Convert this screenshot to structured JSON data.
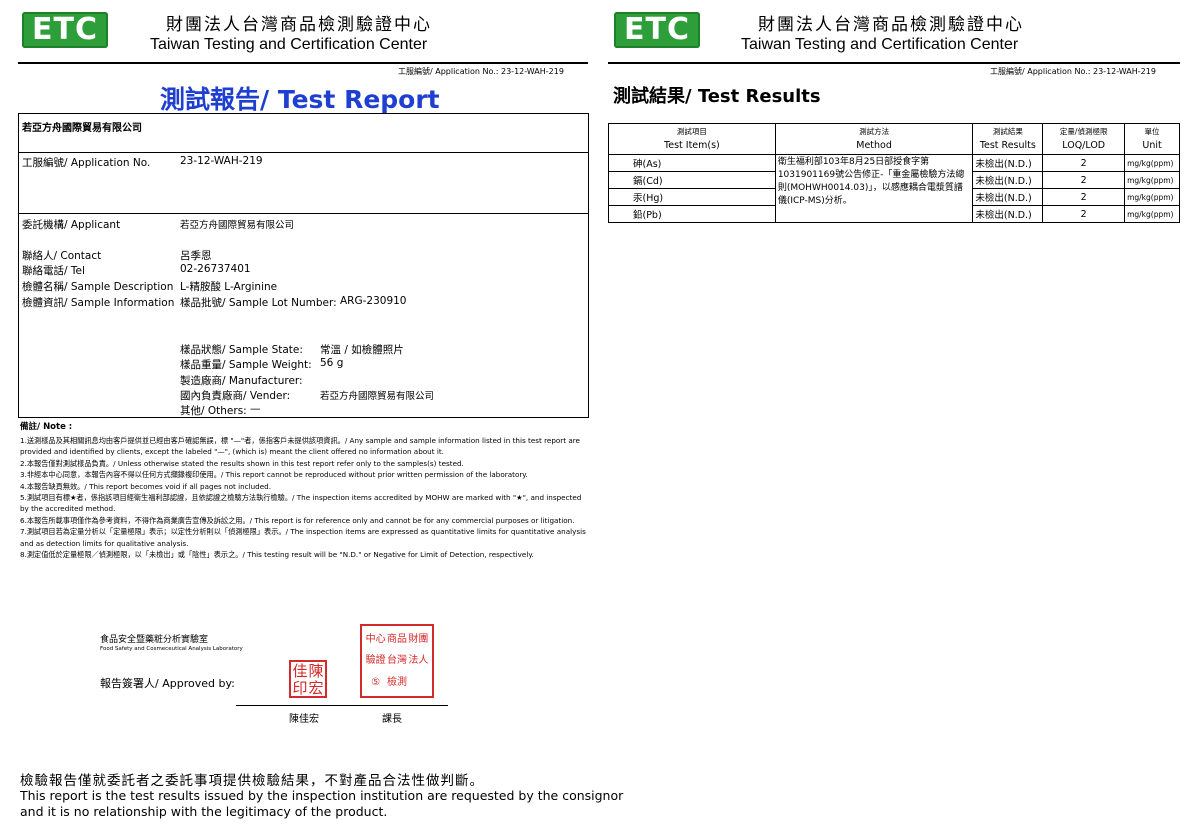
{
  "logo_text": "ETC",
  "org": {
    "zh": "財團法人台灣商品檢測驗證中心",
    "en": "Taiwan Testing and Certification Center"
  },
  "app_no_header": "工服編號/ Application No.:  23-12-WAH-219",
  "left": {
    "title_zh": "測試報告",
    "title_en": "/ Test Report",
    "company": "若亞方舟國際貿易有限公司",
    "fields": {
      "app_no_label": "工服編號/ Application No.",
      "app_no_value": "23-12-WAH-219",
      "applicant_label": "委託機構/ Applicant",
      "applicant_value": "若亞方舟國際貿易有限公司",
      "contact_label": "聯絡人/ Contact",
      "contact_value": "呂季恩",
      "tel_label": "聯絡電話/ Tel",
      "tel_value": "02-26737401",
      "desc_label": "檢體名稱/ Sample Description",
      "desc_value": "L-精胺酸 L-Arginine",
      "info_label": "檢體資訊/ Sample Information",
      "lot_label": "樣品批號/ Sample Lot Number:",
      "lot_value": "ARG-230910",
      "state_label": "樣品狀態/ Sample State:",
      "state_value": "常溫 / 如檢體照片",
      "weight_label": "樣品重量/ Sample Weight:",
      "weight_value": "56 g",
      "manufacturer_label": "製造廠商/ Manufacturer:",
      "vender_label": "國內負責廠商/ Vender:",
      "vender_value": "若亞方舟國際貿易有限公司",
      "others_label": "其他/ Others:",
      "others_value": "—"
    },
    "note_title": "備註/ Note :",
    "notes": [
      "1.送測樣品及其相關訊息均由客戶提供並已經由客戶確認無誤，標 \"—\"者，係指客戶未提供該項資訊。/ Any sample and sample information listed in this test report are provided and identified by clients, except the labeled \"—\", (which is) meant the client offered no information about it.",
      "2.本報告僅對測試樣品負責。/ Unless otherwise stated the results shown in this test report refer only to the samples(s) tested.",
      "3.非經本中心同意，本報告內容不得以任何方式擷錄複印使用。/ This report cannot be reproduced without prior written permission of the laboratory.",
      "4.本報告缺頁無效。/ This report becomes void if all pages not included.",
      "5.測試項目有標★者，係指該項目經衛生福利部認證，且依認證之檢驗方法執行檢驗。/ The inspection items accredited by MOHW are marked with \"★\", and inspected by the accredited method.",
      "6.本報告所載事項僅作為參考資料，不得作為商業廣告宣傳及訴訟之用。/ This report is for reference only and cannot be for any commercial purposes or litigation.",
      "7.測試項目若為定量分析以「定量極限」表示；以定性分析則以「偵測極限」表示。/ The inspection items are expressed as quantitative limits for quantitative analysis and as detection limits for qualitative analysis.",
      "8.測定值低於定量極限／偵測極限，以「未檢出」或「陰性」表示之。/ This testing result will be \"N.D.\" or Negative for Limit of Detection, respectively."
    ],
    "lab_zh": "食品安全暨藥粧分析實驗室",
    "lab_en": "Food Safety and Cosmeceutical Analysis Laboratory",
    "approved_label": "報告簽署人/ Approved by:",
    "stamp_small": [
      "陳",
      "佳",
      "宏",
      "印"
    ],
    "stamp_big": [
      "財團",
      "法人",
      "台灣",
      "商品",
      "檢測",
      "驗證",
      "中心",
      "⑤"
    ],
    "signer_name": "陳佳宏",
    "signer_title": "課長",
    "disclaimer_zh": "檢驗報告僅就委託者之委託事項提供檢驗結果，不對產品合法性做判斷。",
    "disclaimer_en_1": "This report is the test results issued by the inspection institution are requested by the consignor",
    "disclaimer_en_2": "and it is no relationship with the legitimacy of the product."
  },
  "right": {
    "title": "測試結果/ Test Results",
    "headers": [
      {
        "zh": "測試項目",
        "en": "Test Item(s)"
      },
      {
        "zh": "測試方法",
        "en": "Method"
      },
      {
        "zh": "測試結果",
        "en": "Test Results"
      },
      {
        "zh": "定量/偵測極限",
        "en": "LOQ/LOD"
      },
      {
        "zh": "單位",
        "en": "Unit"
      }
    ],
    "method_text": "衛生福利部103年8月25日部授食字第1031901169號公告修正-「重金屬檢驗方法總則(MOHWH0014.03)」，以感應耦合電漿質譜儀(ICP-MS)分析。",
    "rows": [
      {
        "item": "砷(As)",
        "result": "未檢出(N.D.)",
        "loq": "2",
        "unit": "mg/kg(ppm)"
      },
      {
        "item": "鎘(Cd)",
        "result": "未檢出(N.D.)",
        "loq": "2",
        "unit": "mg/kg(ppm)"
      },
      {
        "item": "汞(Hg)",
        "result": "未檢出(N.D.)",
        "loq": "2",
        "unit": "mg/kg(ppm)"
      },
      {
        "item": "鉛(Pb)",
        "result": "未檢出(N.D.)",
        "loq": "2",
        "unit": "mg/kg(ppm)"
      }
    ]
  },
  "colors": {
    "logo_green": "#2e9e3a",
    "title_blue": "#1e3fd0",
    "stamp_red": "#d42a2a"
  }
}
